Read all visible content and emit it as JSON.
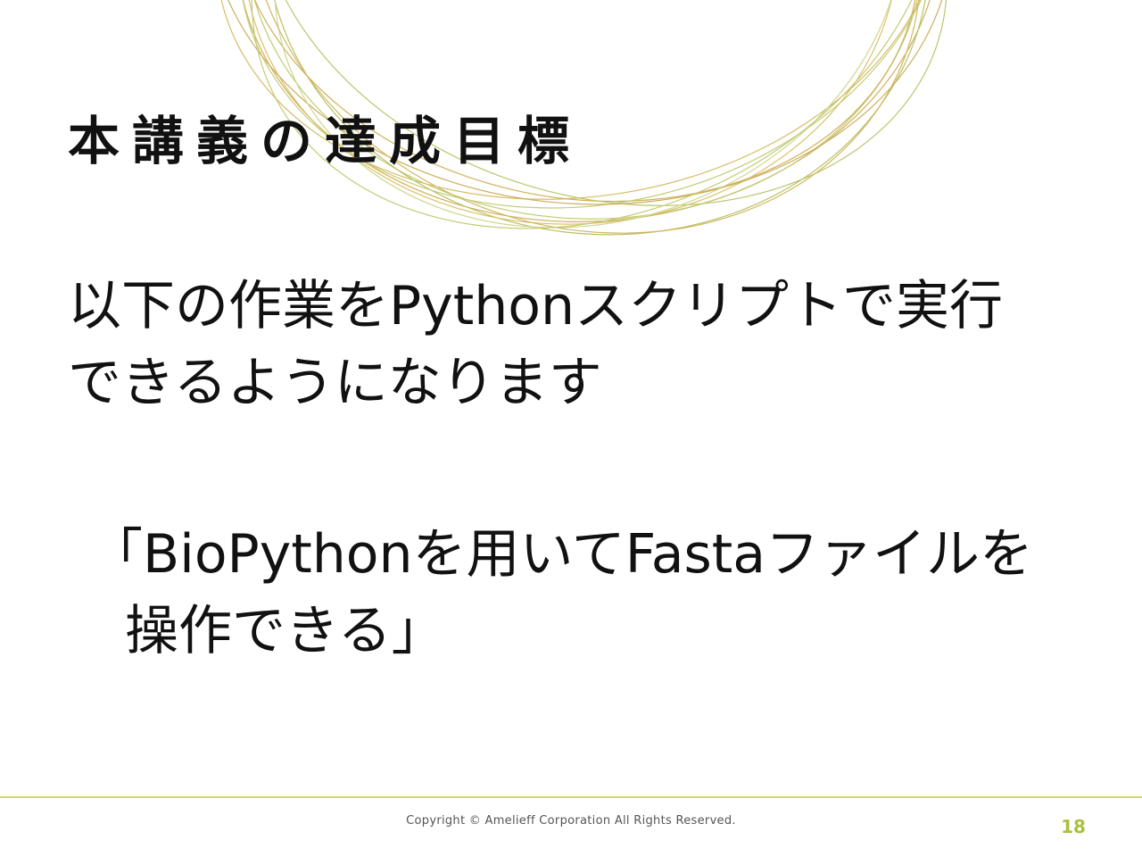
{
  "slide": {
    "title": "本講義の達成目標",
    "body_lines": [
      "以下の作業をPythonスクリプトで実行",
      "できるようになります"
    ],
    "goal_lines": [
      "「BioPythonを用いてFastaファイルを",
      "操作できる」"
    ]
  },
  "footer": {
    "copyright": "Copyright © Amelieff Corporation All Rights Reserved.",
    "page_number": "18"
  },
  "colors": {
    "accent": "#a9c23a",
    "rule": "#cdd96a",
    "ring_gold": "#c9a23a",
    "ring_green": "#b5c25a",
    "text": "#111111"
  }
}
